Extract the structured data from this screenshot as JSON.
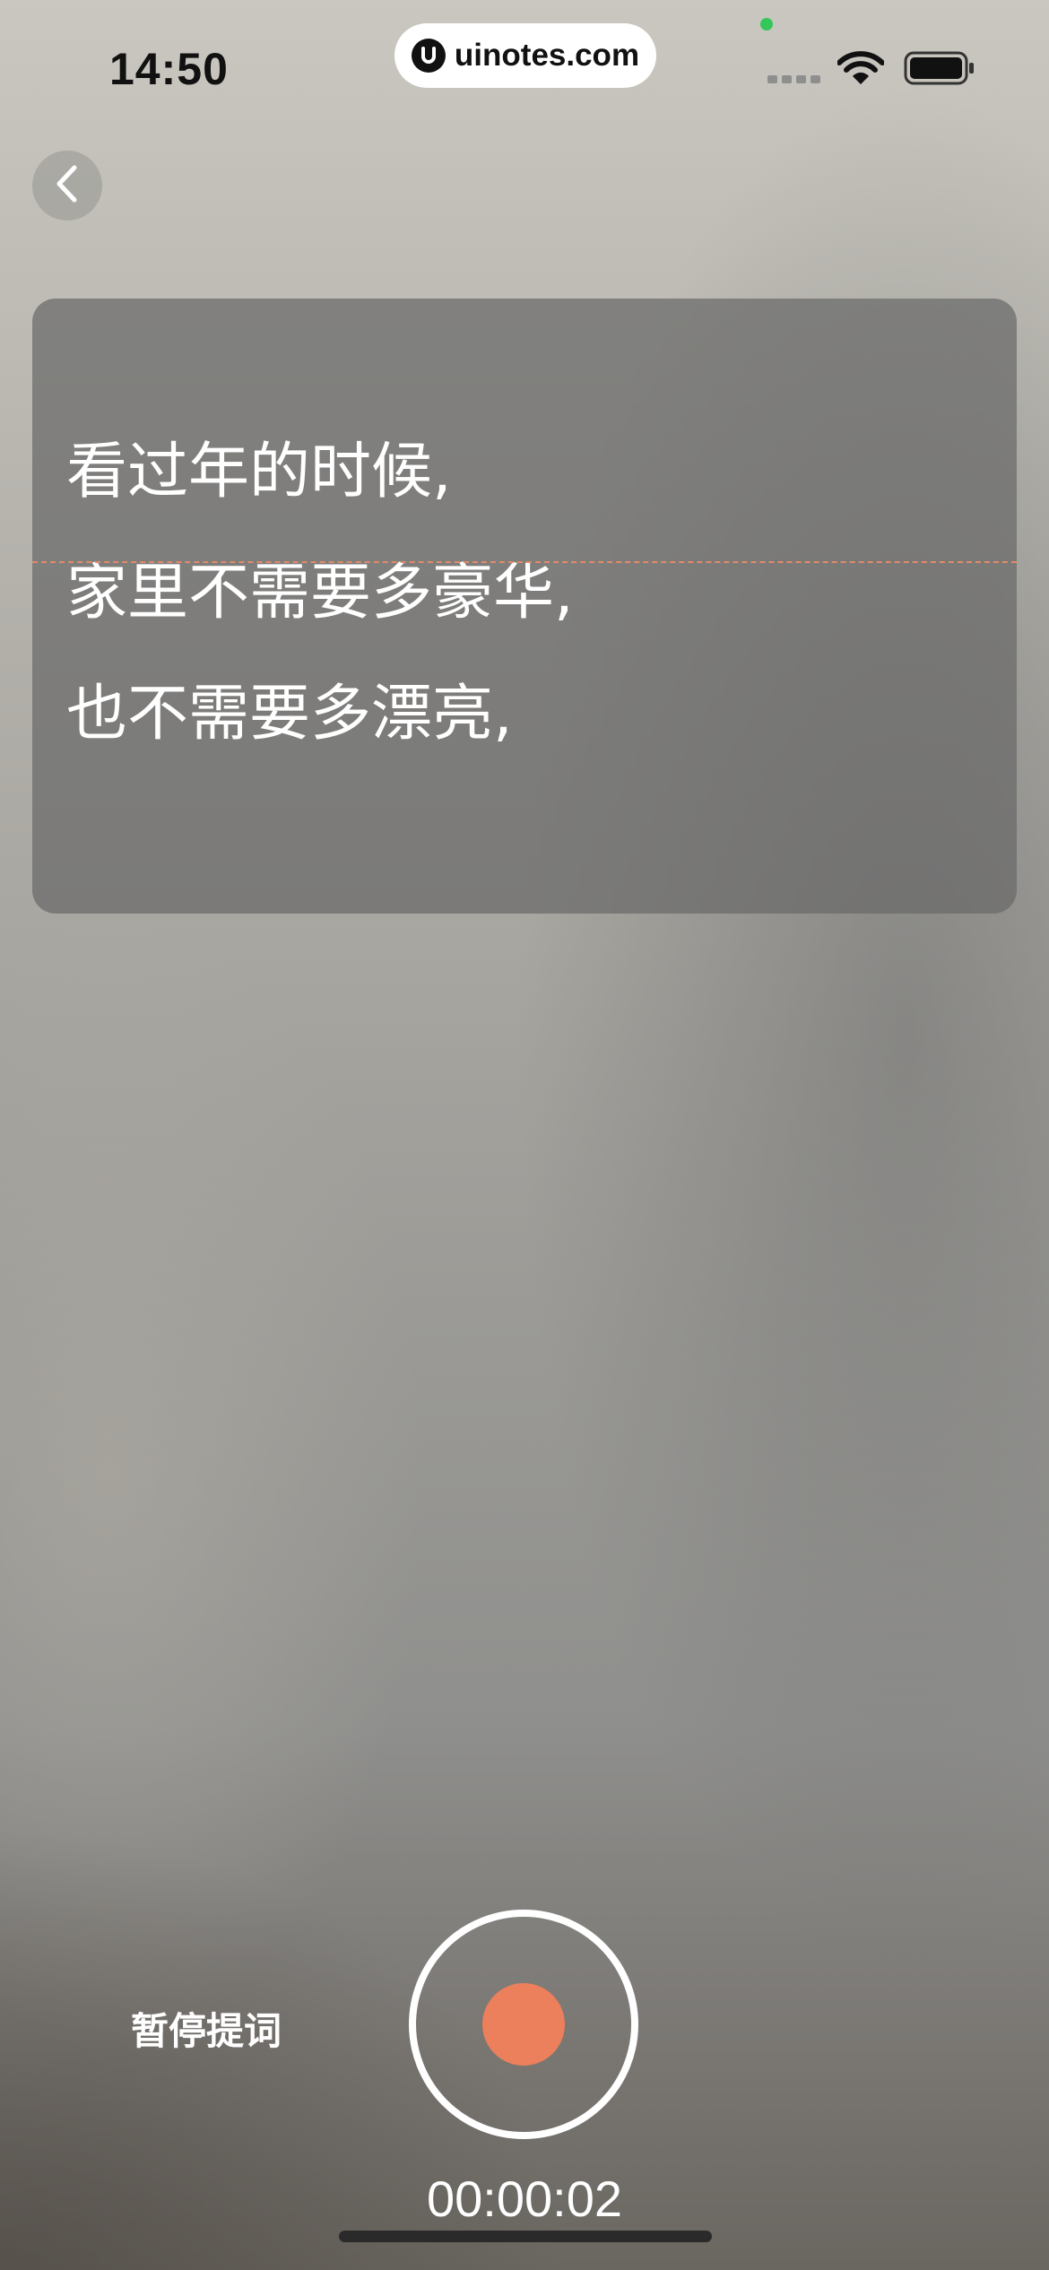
{
  "status_bar": {
    "time": "14:50",
    "url": "uinotes.com",
    "icons": [
      "signal-icon",
      "wifi-icon",
      "battery-icon"
    ]
  },
  "nav": {
    "back_icon": "chevron-left-icon"
  },
  "teleprompter": {
    "lines": [
      "看过年的时候,",
      "家里不需要多豪华,",
      "也不需要多漂亮,"
    ],
    "guide_color": "#e48a68"
  },
  "controls": {
    "pause_prompter_label": "暂停提词",
    "record_color": "#ec7f5c",
    "timer": "00:00:02"
  }
}
